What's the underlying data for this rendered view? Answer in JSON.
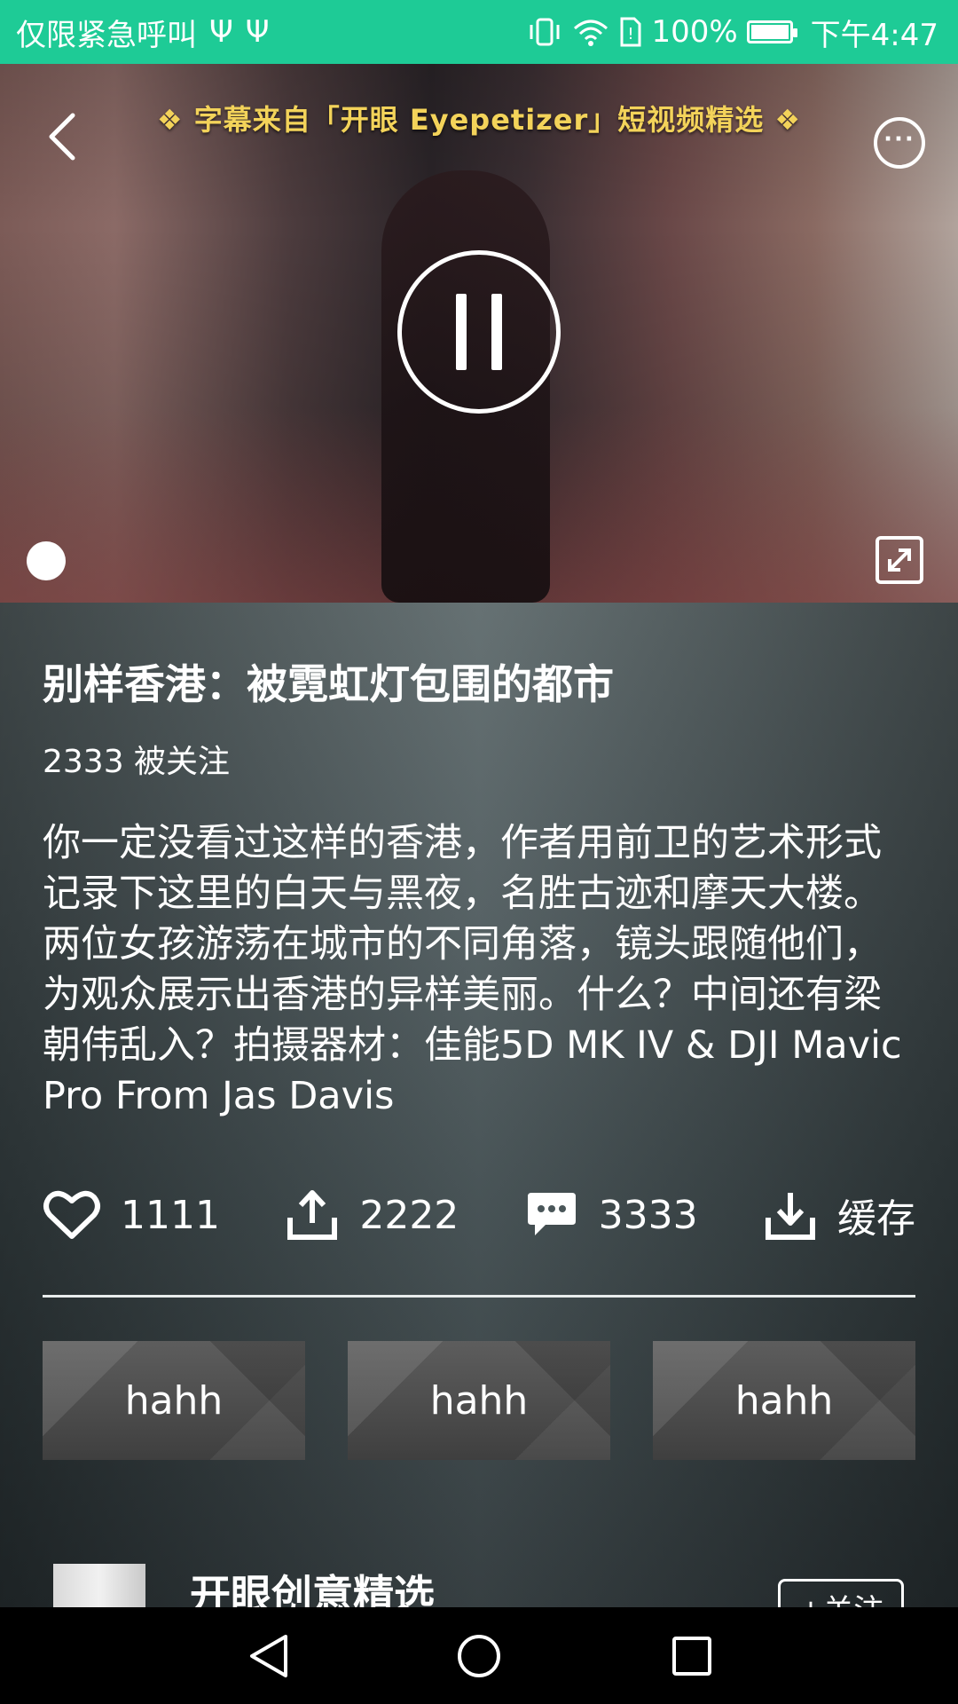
{
  "status_bar": {
    "carrier": "仅限紧急呼叫",
    "usb_icons": [
      "usb-icon",
      "usb-icon"
    ],
    "battery_percent": "100%",
    "time": "下午4:47",
    "bg_color": "#1ecb96"
  },
  "video": {
    "subtitle": "❖ 字幕来自「开眼 Eyepetizer」短视频精选 ❖",
    "state": "playing",
    "progress_fraction": 0.0
  },
  "details": {
    "title": "别样香港：被霓虹灯包围的都市",
    "followers": "2333 被关注",
    "description": "你一定没看过这样的香港，作者用前卫的艺术形式记录下这里的白天与黑夜，名胜古迹和摩天大楼。两位女孩游荡在城市的不同角落，镜头跟随他们，为观众展示出香港的异样美丽。什么？中间还有梁朝伟乱入？拍摄器材：佳能5D MK IV & DJI Mavic Pro From Jas Davis"
  },
  "actions": {
    "like_count": "1111",
    "share_count": "2222",
    "comment_count": "3333",
    "cache_label": "缓存"
  },
  "tags": [
    "hahh",
    "hahh",
    "hahh"
  ],
  "author": {
    "name": "开眼创意精选",
    "follow_label": "+关注"
  }
}
